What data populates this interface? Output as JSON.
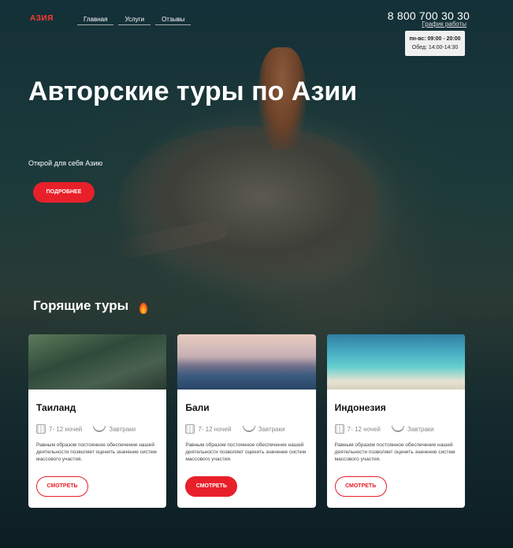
{
  "header": {
    "logo": "АЗИЯ",
    "nav": [
      "Главная",
      "Услуги",
      "Отзывы"
    ],
    "phone": "8 800 700 30 30",
    "schedule_link": "График работы",
    "schedule": {
      "days": "пн-вс:",
      "hours": "09:00 - 20:00",
      "lunch": "Обед: 14:00-14:30"
    }
  },
  "hero": {
    "title": "Авторские туры по Азии",
    "subtitle": "Открой для себя Азию",
    "button": "ПОДРОБНЕЕ"
  },
  "hot": {
    "title": "Горящие туры",
    "cards": [
      {
        "name": "Таиланд",
        "nights": "7- 12 ночей",
        "meals": "Завтраки",
        "desc": "Равным образом постоянное обеспечение нашей деятельности позволяет оценить значение систем массового участия.",
        "button": "СМОТРЕТЬ"
      },
      {
        "name": "Бали",
        "nights": "7- 12 ночей",
        "meals": "Завтраки",
        "desc": "Равным образом постоянное обеспечение нашей деятельности позволяет оценить значение систем массового участия.",
        "button": "СМОТРЕТЬ"
      },
      {
        "name": "Индонезия",
        "nights": "7- 12 ночей",
        "meals": "Завтраки",
        "desc": "Равным образом постоянное обеспечение нашей деятельности позволяет оценить значение систем массового участия.",
        "button": "СМОТРЕТЬ"
      }
    ]
  },
  "colors": {
    "accent": "#e8202a",
    "dark": "#0f2128"
  }
}
